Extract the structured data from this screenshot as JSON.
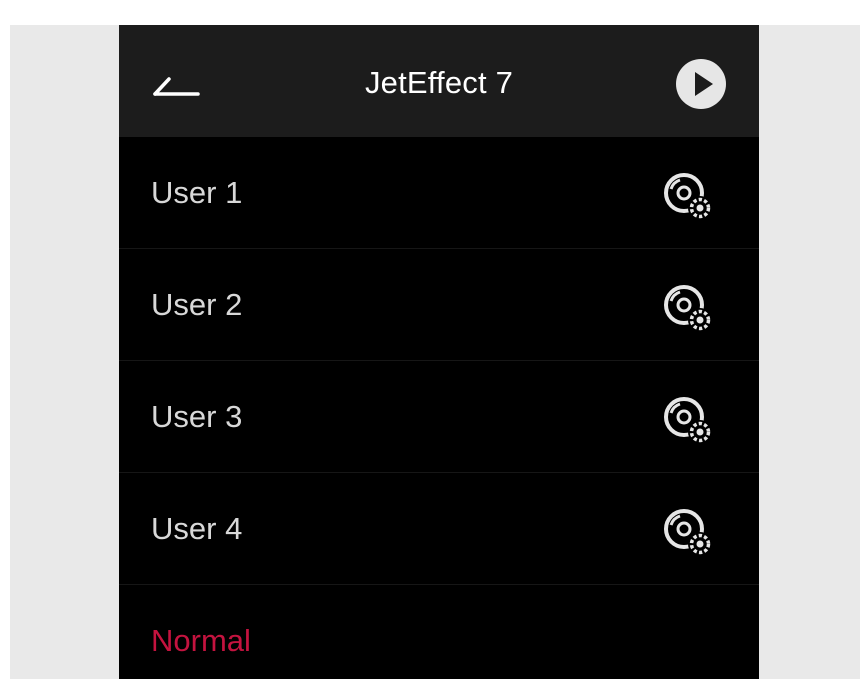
{
  "app": {
    "title": "JetEffect 7"
  },
  "header": {
    "back_icon": "back-arrow-icon",
    "play_icon": "play-icon"
  },
  "presets": [
    {
      "label": "User 1",
      "icon": "disc-settings-icon"
    },
    {
      "label": "User 2",
      "icon": "disc-settings-icon"
    },
    {
      "label": "User 3",
      "icon": "disc-settings-icon"
    },
    {
      "label": "User 4",
      "icon": "disc-settings-icon"
    }
  ],
  "normal": {
    "label": "Normal"
  },
  "colors": {
    "background": "#e9e9e9",
    "panel": "#000000",
    "header": "#1c1c1c",
    "text": "#d8d8d8",
    "accent": "#c4133f"
  }
}
